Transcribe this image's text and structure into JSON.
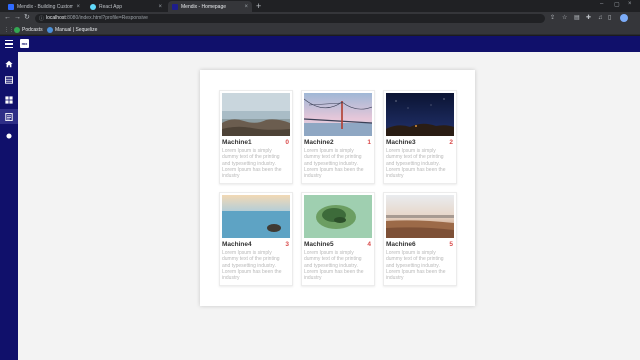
{
  "browser": {
    "tabs": [
      {
        "title": "Mendix - Building Custom Plugg...",
        "favicon_color": "#2f6bff",
        "active": false
      },
      {
        "title": "React App",
        "favicon_color": "#61dafb",
        "active": false
      },
      {
        "title": "Mendix - Homepage",
        "favicon_color": "#1e1e8c",
        "active": true
      }
    ],
    "address": {
      "host": "localhost",
      "path": ":8080/index.html?profile=Responsive"
    },
    "bookmarks": [
      {
        "label": "Podcasts",
        "color": "#34a853"
      },
      {
        "label": "Manual | Sequelize",
        "color": "#4a90d9"
      }
    ]
  },
  "app": {
    "logo_text": "mx",
    "nav_items": [
      {
        "icon": "home-icon",
        "active": false
      },
      {
        "icon": "list-icon",
        "active": false
      },
      {
        "icon": "grid-icon",
        "active": false
      },
      {
        "icon": "document-icon",
        "active": true
      },
      {
        "icon": "dot-icon",
        "active": false
      }
    ]
  },
  "cards": [
    {
      "name": "Machine1",
      "index": "0",
      "image": "rocks-shore",
      "description": "Lorem Ipsum is simply dummy text of the printing and typesetting industry. Lorem Ipsum has been the industry"
    },
    {
      "name": "Machine2",
      "index": "1",
      "image": "bridge-dusk",
      "description": "Lorem Ipsum is simply dummy text of the printing and typesetting industry. Lorem Ipsum has been the industry"
    },
    {
      "name": "Machine3",
      "index": "2",
      "image": "night-sky",
      "description": "Lorem Ipsum is simply dummy text of the printing and typesetting industry. Lorem Ipsum has been the industry"
    },
    {
      "name": "Machine4",
      "index": "3",
      "image": "sea-rock",
      "description": "Lorem Ipsum is simply dummy text of the printing and typesetting industry. Lorem Ipsum has been the industry"
    },
    {
      "name": "Machine5",
      "index": "4",
      "image": "green-island",
      "description": "Lorem Ipsum is simply dummy text of the printing and typesetting industry. Lorem Ipsum has been the industry"
    },
    {
      "name": "Machine6",
      "index": "5",
      "image": "beach-sunset",
      "description": "Lorem Ipsum is simply dummy text of the printing and typesetting industry. Lorem Ipsum has been the industry"
    }
  ],
  "colors": {
    "app_bar": "#10106b",
    "index_red": "#d94b4b",
    "content_bg": "#f3f3f3"
  }
}
